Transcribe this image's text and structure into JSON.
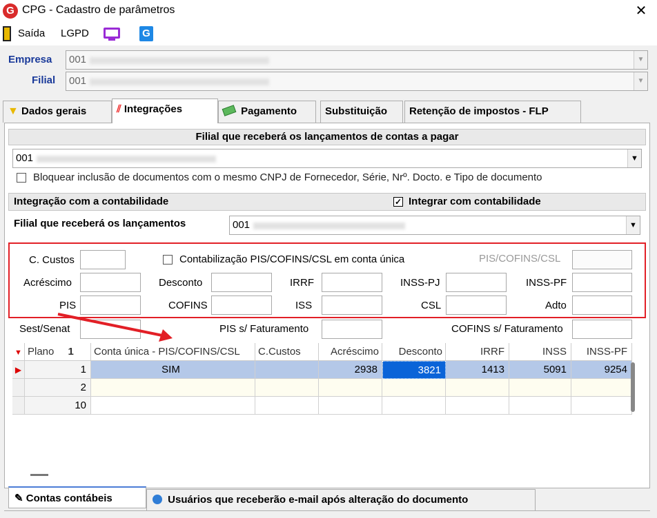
{
  "window": {
    "title": "CPG - Cadastro de parâmetros"
  },
  "toolbar": {
    "exit_label": "Saída",
    "lgpd_label": "LGPD"
  },
  "header": {
    "empresa_label": "Empresa",
    "empresa_value": "001",
    "filial_label": "Filial",
    "filial_value": "001"
  },
  "tabs": [
    "Dados gerais",
    "Integrações",
    "Pagamento",
    "Substituição",
    "Retenção de impostos - FLP"
  ],
  "section1": {
    "title": "Filial que receberá os lançamentos de contas a pagar",
    "filial_value": "001",
    "block_label": "Bloquear inclusão de documentos com o mesmo CNPJ de Fornecedor, Série, Nrº. Docto. e Tipo de documento"
  },
  "section2": {
    "title": "Integração com a contabilidade",
    "integrate_label": "Integrar com contabilidade",
    "filial_label": "Filial que receberá os lançamentos",
    "filial_value": "001"
  },
  "fields": {
    "ccustos": "C. Custos",
    "contab_unica": "Contabilização PIS/COFINS/CSL em conta única",
    "pis_cofins_csl": "PIS/COFINS/CSL",
    "acrescimo": "Acréscimo",
    "desconto": "Desconto",
    "irrf": "IRRF",
    "inss_pj": "INSS-PJ",
    "inss_pf": "INSS-PF",
    "pis": "PIS",
    "cofins": "COFINS",
    "iss": "ISS",
    "csl": "CSL",
    "adto": "Adto",
    "sest_senat": "Sest/Senat",
    "pis_fat": "PIS s/ Faturamento",
    "cofins_fat": "COFINS s/ Faturamento"
  },
  "grid": {
    "columns": [
      "Plano",
      "Conta única - PIS/COFINS/CSL",
      "C.Custos",
      "Acréscimo",
      "Desconto",
      "IRRF",
      "INSS",
      "INSS-PF"
    ],
    "sort_indicator": "1",
    "rows": [
      {
        "plano": "1",
        "conta_unica": "SIM",
        "ccustos": "",
        "acrescimo": "2938",
        "desconto": "3821",
        "irrf": "1413",
        "inss": "5091",
        "inss_pf": "9254"
      },
      {
        "plano": "2",
        "conta_unica": "",
        "ccustos": "",
        "acrescimo": "",
        "desconto": "",
        "irrf": "",
        "inss": "",
        "inss_pf": ""
      },
      {
        "plano": "10",
        "conta_unica": "",
        "ccustos": "",
        "acrescimo": "",
        "desconto": "",
        "irrf": "",
        "inss": "",
        "inss_pf": ""
      }
    ]
  },
  "bottom_tabs": [
    "Contas contábeis",
    "Usuários que receberão e-mail após alteração do documento"
  ],
  "colors": {
    "annotation_red": "#e21f26",
    "label_blue": "#1a3a9a",
    "selected_row": "#b4c8e8",
    "selected_cell": "#0a64d8"
  }
}
